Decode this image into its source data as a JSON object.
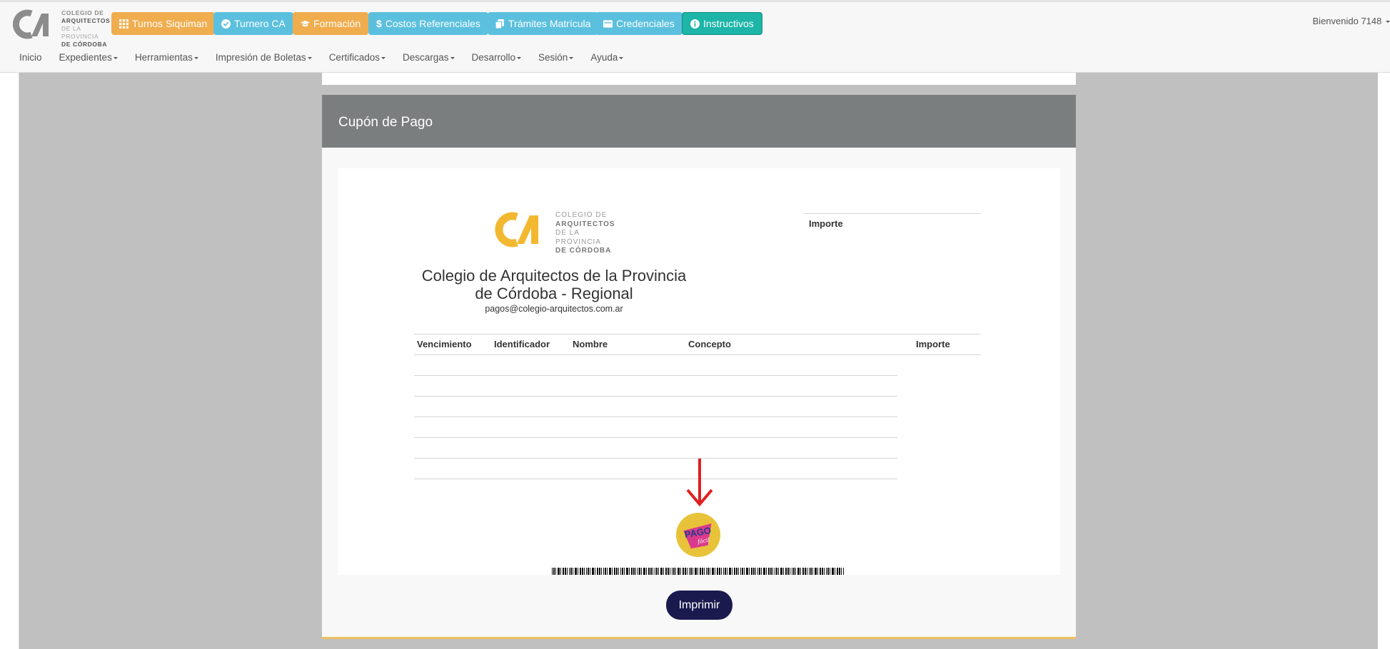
{
  "brand": {
    "logo_lines": [
      "COLEGIO DE",
      "ARQUITECTOS",
      "DE LA PROVINCIA",
      "DE CÓRDOBA"
    ],
    "accent_color": "#f0ad4e",
    "teal_color": "#1cb5a8",
    "info_color": "#5bc0de"
  },
  "toolbar": {
    "buttons": [
      {
        "label": "Turnos Siquiman",
        "icon": "grid-icon",
        "color": "orange"
      },
      {
        "label": "Turnero CA",
        "icon": "check-circle-icon",
        "color": "blue"
      },
      {
        "label": "Formación",
        "icon": "graduation-cap-icon",
        "color": "orange"
      },
      {
        "label": "Costos Referenciales",
        "icon": "dollar-icon",
        "color": "blue"
      },
      {
        "label": "Trámites Matrícula",
        "icon": "copy-icon",
        "color": "blue"
      },
      {
        "label": "Credenciales",
        "icon": "id-card-icon",
        "color": "blue"
      },
      {
        "label": "Instructivos",
        "icon": "info-circle-icon",
        "color": "teal"
      }
    ]
  },
  "welcome": "Bienvenido 7148",
  "menu": {
    "items": [
      "Inicio",
      "Expedientes",
      "Herramientas",
      "Impresión de Boletas",
      "Certificados",
      "Descargas",
      "Desarrollo",
      "Sesión",
      "Ayuda"
    ]
  },
  "panel": {
    "title": "Cupón de Pago"
  },
  "coupon": {
    "org_logo_lines": [
      "COLEGIO DE",
      "ARQUITECTOS",
      "DE LA PROVINCIA",
      "DE CÓRDOBA"
    ],
    "org_name_line1": "Colegio de Arquitectos de la Provincia",
    "org_name_line2": "de Córdoba - Regional",
    "email": "pagos@colegio-arquitectos.com.ar",
    "total_label": "Importe",
    "columns": [
      "Vencimiento",
      "Identificador",
      "Nombre",
      "Concepto",
      "Importe"
    ],
    "payment_badge": {
      "text": "PAGO",
      "subtext": "fácil"
    }
  },
  "actions": {
    "print_label": "Imprimir"
  }
}
